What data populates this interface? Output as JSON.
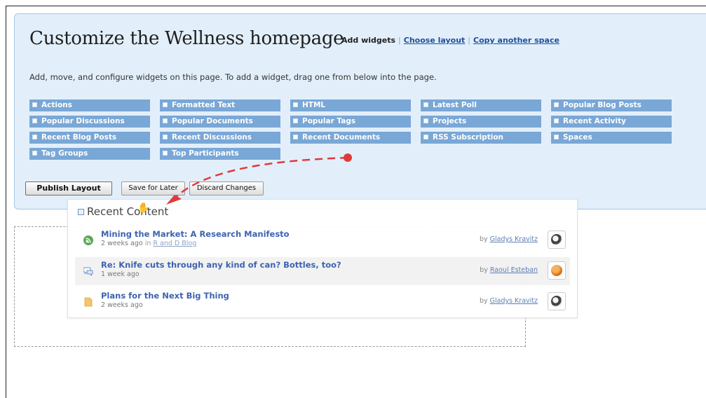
{
  "header": {
    "title": "Customize the Wellness homepage",
    "links": {
      "add_widgets": "Add widgets",
      "choose_layout": "Choose layout",
      "copy_space": "Copy another space",
      "separator": "|"
    },
    "instructions": "Add, move, and configure widgets on this page. To add a widget, drag one from below into the page."
  },
  "widgets": [
    "Actions",
    "Formatted Text",
    "HTML",
    "Latest Poll",
    "Popular Blog Posts",
    "Popular Discussions",
    "Popular Documents",
    "Popular Tags",
    "Projects",
    "Recent Activity",
    "Recent Blog Posts",
    "Recent Discussions",
    "Recent Documents",
    "RSS Subscription",
    "Spaces",
    "Tag Groups",
    "Top Participants"
  ],
  "buttons": {
    "publish": "Publish Layout",
    "save": "Save for Later",
    "discard": "Discard Changes"
  },
  "recent_content": {
    "title": "Recent Content",
    "by_label": "by",
    "in_label": "in",
    "items": [
      {
        "title": "Mining the Market: A Research Manifesto",
        "time": "2 weeks ago",
        "location": "R and D Blog",
        "author": "Gladys Kravitz",
        "icon": "blog-icon"
      },
      {
        "title": "Re: Knife cuts through any kind of can? Bottles, too?",
        "time": "1 week ago",
        "location": "",
        "author": "Raoul Esteban",
        "icon": "discussion-icon"
      },
      {
        "title": "Plans for the Next Big Thing",
        "time": "2 weeks ago",
        "location": "",
        "author": "Gladys Kravitz",
        "icon": "document-icon"
      }
    ]
  },
  "colors": {
    "panel_bg": "#e2effb",
    "widget_chip": "#79a7d6",
    "link": "#1f4f97",
    "drag_arrow": "#e03a3a"
  }
}
